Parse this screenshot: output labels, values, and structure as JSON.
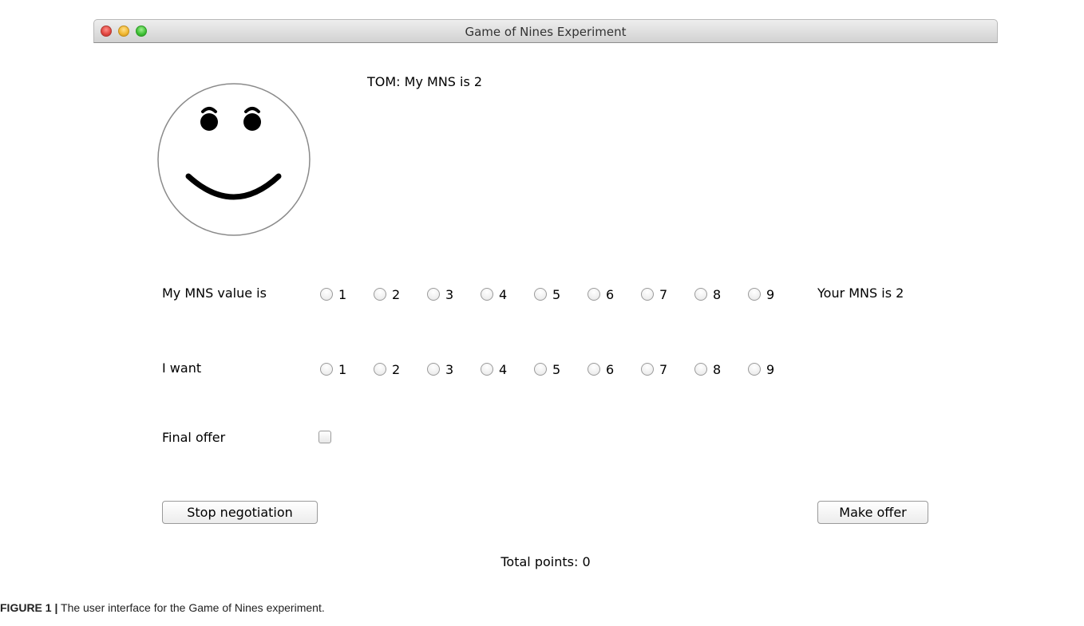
{
  "window": {
    "title": "Game of Nines Experiment"
  },
  "opponent": {
    "message": "TOM: My MNS is 2",
    "face_icon": "smiley-face-icon"
  },
  "mns_row": {
    "label": "My MNS value is",
    "options": [
      "1",
      "2",
      "3",
      "4",
      "5",
      "6",
      "7",
      "8",
      "9"
    ],
    "selected": null
  },
  "opponent_info": {
    "text": "Your MNS is 2"
  },
  "want_row": {
    "label": "I want",
    "options": [
      "1",
      "2",
      "3",
      "4",
      "5",
      "6",
      "7",
      "8",
      "9"
    ],
    "selected": null
  },
  "final_offer": {
    "label": "Final offer",
    "checked": false
  },
  "buttons": {
    "stop": "Stop negotiation",
    "offer": "Make offer"
  },
  "score": {
    "text": "Total points: 0"
  },
  "caption": {
    "label": "FIGURE 1 |",
    "text": " The user interface for the Game of Nines experiment."
  },
  "colors": {
    "titlebar": "#d2d2d2",
    "close": "#e0443e",
    "minimize": "#f0b52e",
    "maximize": "#3cbf33"
  }
}
